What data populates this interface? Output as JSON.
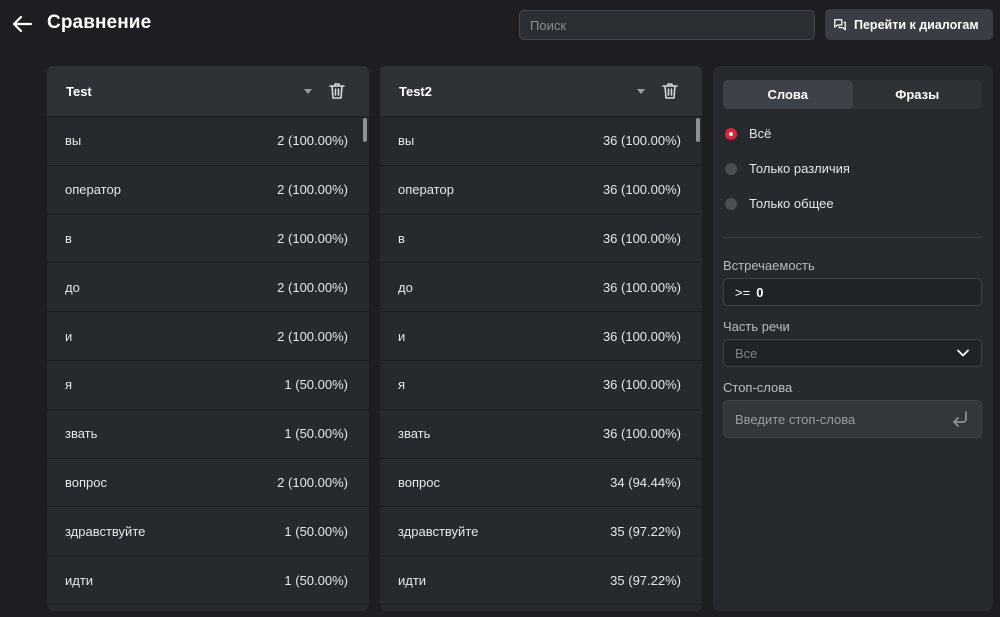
{
  "header": {
    "title": "Сравнение",
    "search_placeholder": "Поиск",
    "dialogs_button": "Перейти к диалогам"
  },
  "columns": [
    {
      "title": "Test",
      "rows": [
        {
          "word": "вы",
          "value": "2 (100.00%)"
        },
        {
          "word": "оператор",
          "value": "2 (100.00%)"
        },
        {
          "word": "в",
          "value": "2 (100.00%)"
        },
        {
          "word": "до",
          "value": "2 (100.00%)"
        },
        {
          "word": "и",
          "value": "2 (100.00%)"
        },
        {
          "word": "я",
          "value": "1 (50.00%)"
        },
        {
          "word": "звать",
          "value": "1 (50.00%)"
        },
        {
          "word": "вопрос",
          "value": "2 (100.00%)"
        },
        {
          "word": "здравствуйте",
          "value": "1 (50.00%)"
        },
        {
          "word": "идти",
          "value": "1 (50.00%)"
        }
      ]
    },
    {
      "title": "Test2",
      "rows": [
        {
          "word": "вы",
          "value": "36 (100.00%)"
        },
        {
          "word": "оператор",
          "value": "36 (100.00%)"
        },
        {
          "word": "в",
          "value": "36 (100.00%)"
        },
        {
          "word": "до",
          "value": "36 (100.00%)"
        },
        {
          "word": "и",
          "value": "36 (100.00%)"
        },
        {
          "word": "я",
          "value": "36 (100.00%)"
        },
        {
          "word": "звать",
          "value": "36 (100.00%)"
        },
        {
          "word": "вопрос",
          "value": "34 (94.44%)"
        },
        {
          "word": "здравствуйте",
          "value": "35 (97.22%)"
        },
        {
          "word": "идти",
          "value": "35 (97.22%)"
        }
      ]
    }
  ],
  "panel": {
    "tabs": [
      {
        "label": "Слова",
        "active": true
      },
      {
        "label": "Фразы",
        "active": false
      }
    ],
    "filters": [
      {
        "label": "Всё",
        "selected": true
      },
      {
        "label": "Только различия",
        "selected": false
      },
      {
        "label": "Только общее",
        "selected": false
      }
    ],
    "frequency_label": "Встречаемость",
    "frequency_operator": ">=",
    "frequency_value": "0",
    "pos_label": "Часть речи",
    "pos_value": "Все",
    "stopwords_label": "Стоп-слова",
    "stopwords_placeholder": "Введите стоп-слова"
  },
  "colors": {
    "background": "#1c1e21",
    "card": "#26292d",
    "accent_radio": "#e0213a"
  },
  "icons": [
    "back-arrow-icon",
    "chat-bubbles-icon",
    "caret-down-icon",
    "trash-icon",
    "chevron-down-icon",
    "enter-icon"
  ]
}
